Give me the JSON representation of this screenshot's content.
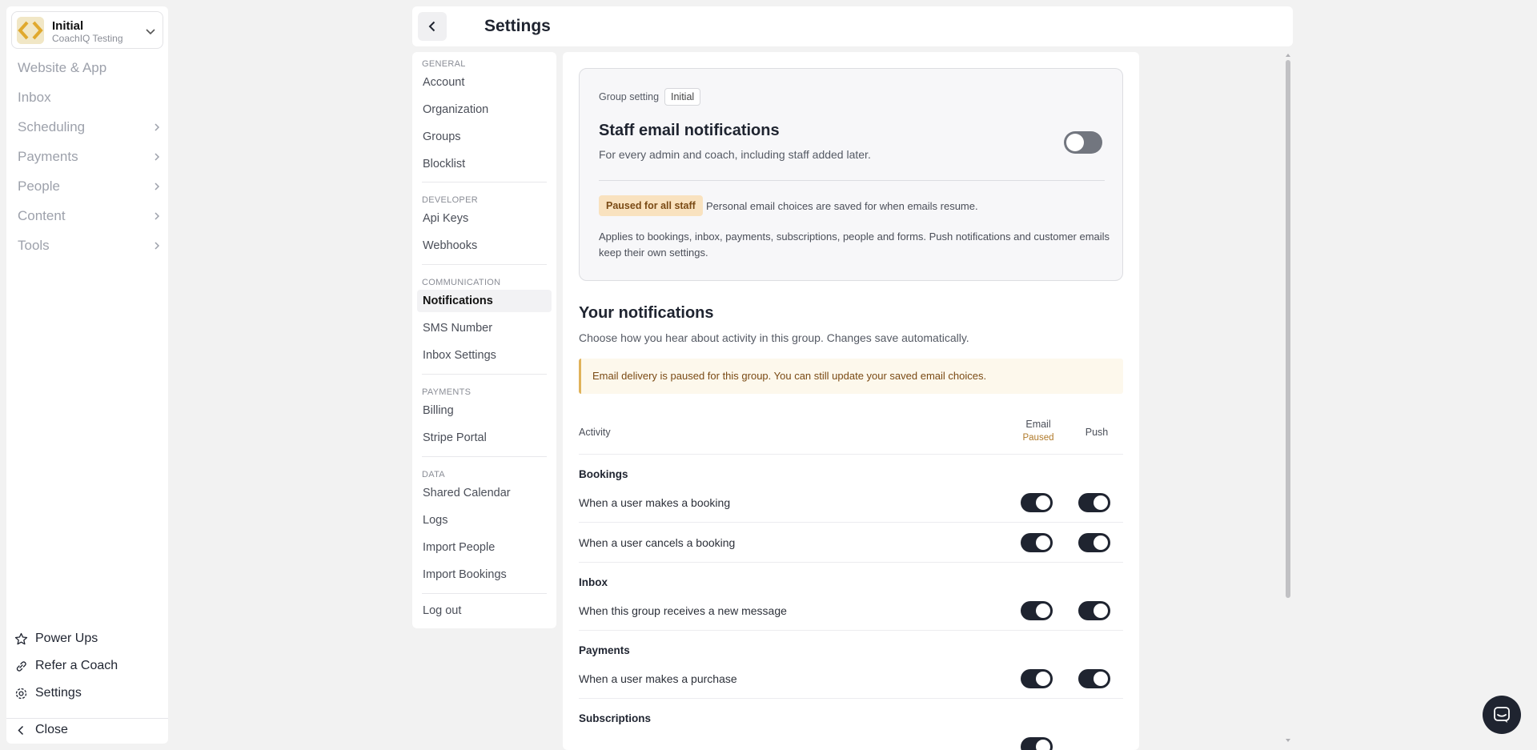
{
  "org": {
    "name": "Initial",
    "subtitle": "CoachIQ Testing"
  },
  "sidebar": {
    "items": [
      {
        "label": "Website & App",
        "chevron": false
      },
      {
        "label": "Inbox",
        "chevron": false
      },
      {
        "label": "Scheduling",
        "chevron": true
      },
      {
        "label": "Payments",
        "chevron": true
      },
      {
        "label": "People",
        "chevron": true
      },
      {
        "label": "Content",
        "chevron": true
      },
      {
        "label": "Tools",
        "chevron": true
      }
    ],
    "bottom": [
      {
        "label": "Power Ups",
        "icon": "star-icon"
      },
      {
        "label": "Refer a Coach",
        "icon": "link-icon"
      },
      {
        "label": "Settings",
        "icon": "gear-icon"
      }
    ],
    "close_label": "Close"
  },
  "header": {
    "title": "Settings"
  },
  "settings_nav": {
    "sections": [
      {
        "label": "GENERAL",
        "items": [
          "Account",
          "Organization",
          "Groups",
          "Blocklist"
        ]
      },
      {
        "label": "DEVELOPER",
        "items": [
          "Api Keys",
          "Webhooks"
        ]
      },
      {
        "label": "COMMUNICATION",
        "items": [
          "Notifications",
          "SMS Number",
          "Inbox Settings"
        ]
      },
      {
        "label": "PAYMENTS",
        "items": [
          "Billing",
          "Stripe Portal"
        ]
      },
      {
        "label": "DATA",
        "items": [
          "Shared Calendar",
          "Logs",
          "Import People",
          "Import Bookings"
        ]
      }
    ],
    "active": "Notifications",
    "logout": "Log out"
  },
  "group_setting": {
    "label": "Group setting",
    "badge": "Initial",
    "title": "Staff email notifications",
    "description": "For every admin and coach, including staff added later.",
    "toggle_on": false,
    "paused_badge": "Paused for all staff",
    "paused_note": "Personal email choices are saved for when emails resume.",
    "applies": "Applies to bookings, inbox, payments, subscriptions, people and forms. Push notifications and customer emails keep their own settings."
  },
  "your_notifications": {
    "title": "Your notifications",
    "description": "Choose how you hear about activity in this group. Changes save automatically.",
    "alert": "Email delivery is paused for this group. You can still update your saved email choices.",
    "columns": {
      "activity": "Activity",
      "email": "Email",
      "email_sub": "Paused",
      "push": "Push"
    },
    "categories": [
      {
        "name": "Bookings",
        "rows": [
          {
            "label": "When a user makes a booking",
            "email": true,
            "push": true
          },
          {
            "label": "When a user cancels a booking",
            "email": true,
            "push": true
          }
        ]
      },
      {
        "name": "Inbox",
        "rows": [
          {
            "label": "When this group receives a new message",
            "email": true,
            "push": true
          }
        ]
      },
      {
        "name": "Payments",
        "rows": [
          {
            "label": "When a user makes a purchase",
            "email": true,
            "push": true
          }
        ]
      },
      {
        "name": "Subscriptions",
        "rows": []
      }
    ]
  },
  "colors": {
    "toggle_on": "#1f2430",
    "toggle_off": "#72767f",
    "paused_bg": "#f9e2bf",
    "alert_border": "#e0b25a"
  }
}
